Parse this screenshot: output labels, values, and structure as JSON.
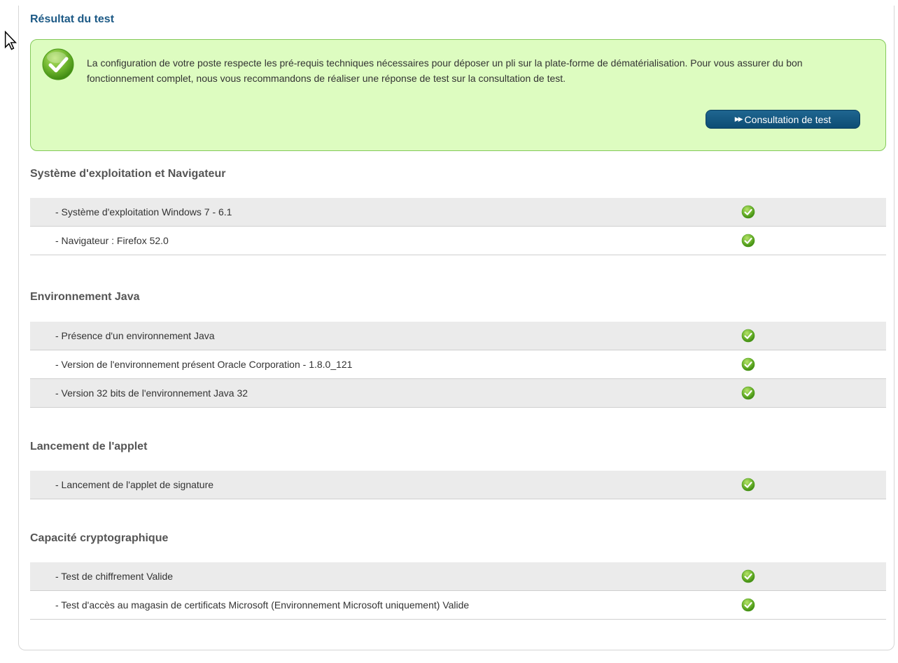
{
  "result": {
    "title": "Résultat du test",
    "message": "La configuration de votre poste respecte les pré-requis techniques nécessaires pour déposer un pli sur la plate-forme de dématérialisation. Pour vous assurer du bon fonctionnement complet, nous vous recommandons de réaliser une réponse de test sur la consultation de test.",
    "button_label": "Consultation de test",
    "button_icon": "double-arrow-right-icon"
  },
  "sections": [
    {
      "title": "Système d'exploitation et Navigateur",
      "items": [
        {
          "label": "- Système d'exploitation Windows 7 - 6.1",
          "status": "ok"
        },
        {
          "label": "- Navigateur : Firefox 52.0",
          "status": "ok"
        }
      ]
    },
    {
      "title": "Environnement Java",
      "items": [
        {
          "label": "- Présence d'un environnement Java",
          "status": "ok"
        },
        {
          "label": "- Version de l'environnement présent Oracle Corporation - 1.8.0_121",
          "status": "ok"
        },
        {
          "label": "- Version 32 bits de l'environnement Java 32",
          "status": "ok"
        }
      ]
    },
    {
      "title": "Lancement de l'applet",
      "items": [
        {
          "label": "- Lancement de l'applet de signature",
          "status": "ok"
        }
      ]
    },
    {
      "title": "Capacité cryptographique",
      "items": [
        {
          "label": "- Test de chiffrement Valide",
          "status": "ok"
        },
        {
          "label": "- Test d'accès au magasin de certificats Microsoft (Environnement Microsoft uniquement) Valide",
          "status": "ok"
        }
      ]
    }
  ],
  "colors": {
    "title_blue": "#1d5a86",
    "alert_bg": "#ddfcc0",
    "alert_border": "#84c95a",
    "check_green": "#7cc142",
    "button_blue": "#0d4d74"
  }
}
